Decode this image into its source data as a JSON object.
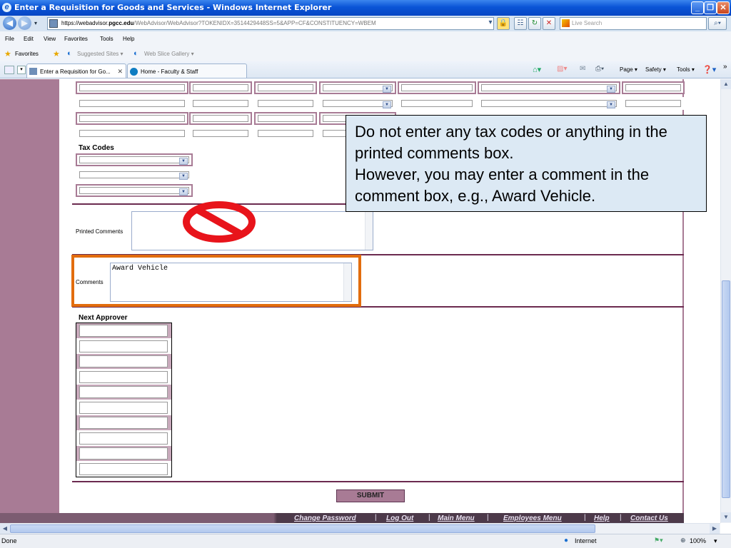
{
  "window": {
    "title": "Enter a Requisition for Goods and Services - Windows Internet Explorer"
  },
  "address": {
    "url_prefix": "https://webadvisor.",
    "url_domain": "pgcc.edu",
    "url_rest": "/WebAdvisor/WebAdvisor?TOKENIDX=3514429448SS=5&APP=CF&CONSTITUENCY=WBEM",
    "search_placeholder": "Live Search"
  },
  "menu": [
    "File",
    "Edit",
    "View",
    "Favorites",
    "Tools",
    "Help"
  ],
  "favorites": {
    "label": "Favorites",
    "suggested": "Suggested Sites ▾",
    "webslice": "Web Slice Gallery ▾"
  },
  "tabs": [
    {
      "label": "Enter a Requisition for Go..."
    },
    {
      "label": "Home - Faculty & Staff"
    }
  ],
  "commands": {
    "page": "Page ▾",
    "safety": "Safety ▾",
    "tools": "Tools ▾"
  },
  "form": {
    "tax_codes_label": "Tax Codes",
    "printed_comments_label": "Printed Comments",
    "comments_label": "Comments",
    "comments_value": "Award Vehicle",
    "next_approver_label": "Next Approver",
    "submit_label": "SUBMIT"
  },
  "callout": {
    "line1": "Do not enter any tax codes or anything in the printed comments box.",
    "line2": "However, you may enter a comment in the comment box, e.g., Award Vehicle."
  },
  "footer_links": [
    "Change Password",
    "Log Out",
    "Main Menu",
    "Employees Menu",
    "Help",
    "Contact Us"
  ],
  "status": {
    "left": "Done",
    "zone": "Internet",
    "zoom": "100%"
  },
  "colors": {
    "accent": "#a87b95",
    "divider": "#6b2a4f",
    "highlight": "#e26d0e",
    "no_sign": "#e8141b"
  }
}
